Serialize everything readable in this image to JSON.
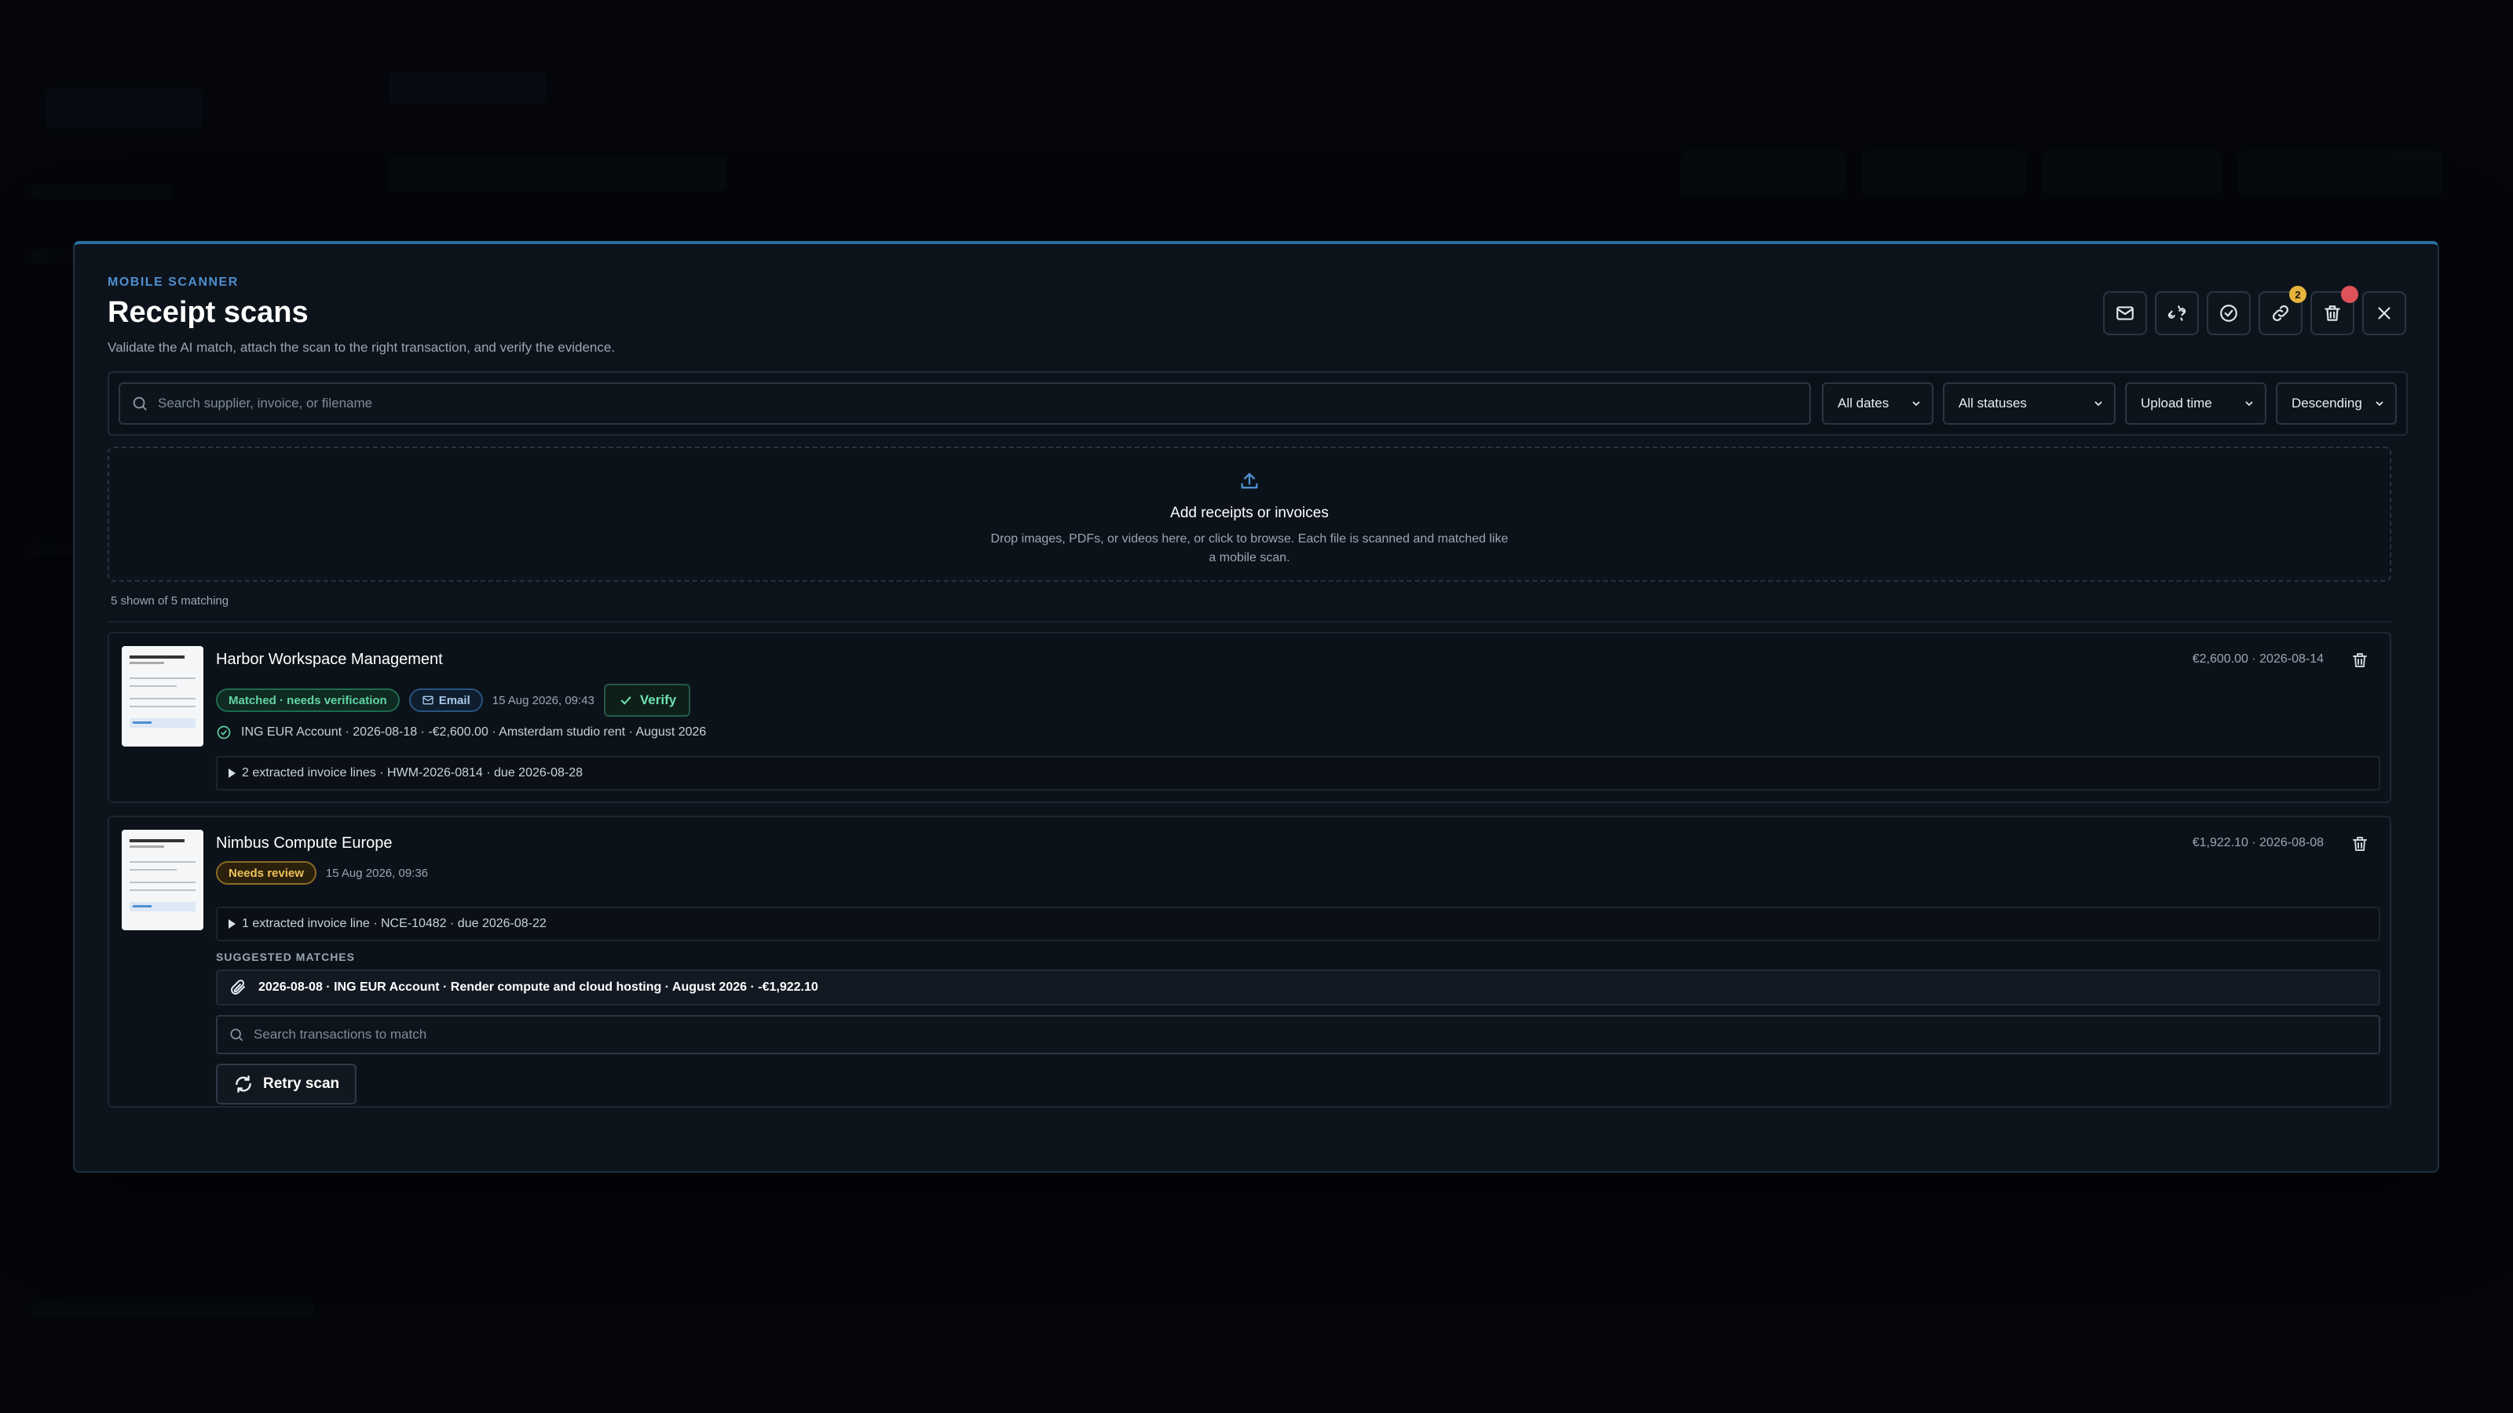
{
  "modal": {
    "eyebrow": "MOBILE SCANNER",
    "title": "Receipt scans",
    "subtitle": "Validate the AI match, attach the scan to the right transaction, and verify the evidence.",
    "toolbar": {
      "badges": {
        "links": "2",
        "trash": ""
      },
      "icons": [
        "mail-icon",
        "unlink-icon",
        "check-circle-icon",
        "link-icon",
        "trash-icon",
        "close-icon"
      ]
    }
  },
  "filters": {
    "search_placeholder": "Search supplier, invoice, or filename",
    "date": "All dates",
    "status": "All statuses",
    "sort_by": "Upload time",
    "order": "Descending"
  },
  "dropzone": {
    "title": "Add receipts or invoices",
    "description": "Drop images, PDFs, or videos here, or click to browse. Each file is scanned and matched like a mobile scan."
  },
  "results": {
    "count_text": "5 shown of 5 matching"
  },
  "scans": [
    {
      "supplier": "Harbor Workspace Management",
      "meta": "€2,600.00 · 2026-08-14",
      "status": "Matched · needs verification",
      "source": "Email",
      "uploaded": "15 Aug 2026, 09:43",
      "verify_label": "Verify",
      "matched_transaction": "ING EUR Account · 2026-08-18 · -€2,600.00 · Amsterdam studio rent · August 2026",
      "lines_summary": "2 extracted invoice lines · HWM-2026-0814 · due 2026-08-28"
    },
    {
      "supplier": "Nimbus Compute Europe",
      "meta": "€1,922.10 · 2026-08-08",
      "status": "Needs review",
      "uploaded": "15 Aug 2026, 09:36",
      "lines_summary": "1 extracted invoice line · NCE-10482 · due 2026-08-22",
      "suggested_label": "SUGGESTED MATCHES",
      "suggestion": "2026-08-08 · ING EUR Account · Render compute and cloud hosting · August 2026 · -€1,922.10",
      "txn_search_placeholder": "Search transactions to match",
      "retry_label": "Retry scan"
    }
  ],
  "colors": {
    "accent": "#4d8fd0",
    "success": "#62d3a4",
    "warning": "#f0c15a",
    "danger": "#e0525a",
    "modal_bg": "#0d131b"
  }
}
